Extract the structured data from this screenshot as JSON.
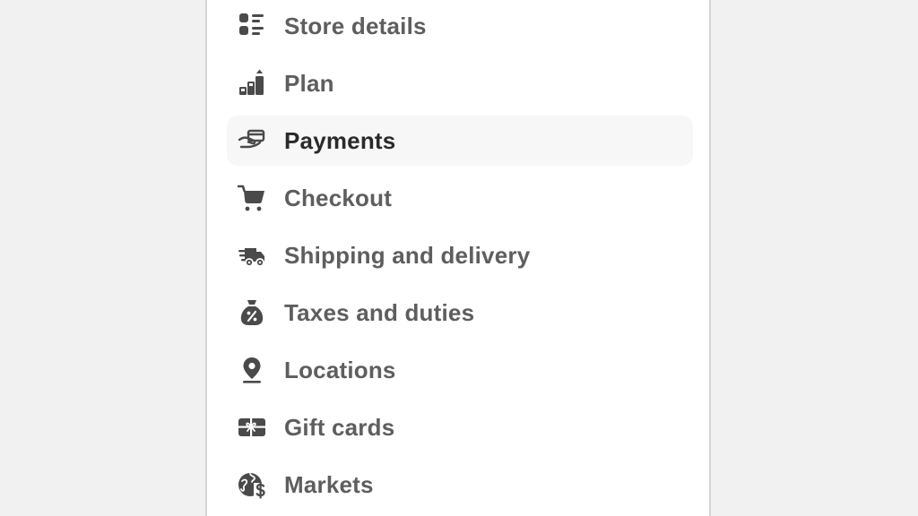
{
  "settings_nav": {
    "items": [
      {
        "label": "Store details",
        "icon": "store-details-icon",
        "active": false
      },
      {
        "label": "Plan",
        "icon": "plan-icon",
        "active": false
      },
      {
        "label": "Payments",
        "icon": "payments-icon",
        "active": true
      },
      {
        "label": "Checkout",
        "icon": "cart-icon",
        "active": false
      },
      {
        "label": "Shipping and delivery",
        "icon": "delivery-truck-icon",
        "active": false
      },
      {
        "label": "Taxes and duties",
        "icon": "tax-bag-icon",
        "active": false
      },
      {
        "label": "Locations",
        "icon": "location-pin-icon",
        "active": false
      },
      {
        "label": "Gift cards",
        "icon": "gift-card-icon",
        "active": false
      },
      {
        "label": "Markets",
        "icon": "globe-dollar-icon",
        "active": false
      }
    ]
  },
  "colors": {
    "background": "#f1f1f1",
    "panel": "#ffffff",
    "active_row": "#f7f7f7",
    "icon": "#4a4a4a",
    "label": "#5e5e5e",
    "label_active": "#2a2a2a"
  }
}
